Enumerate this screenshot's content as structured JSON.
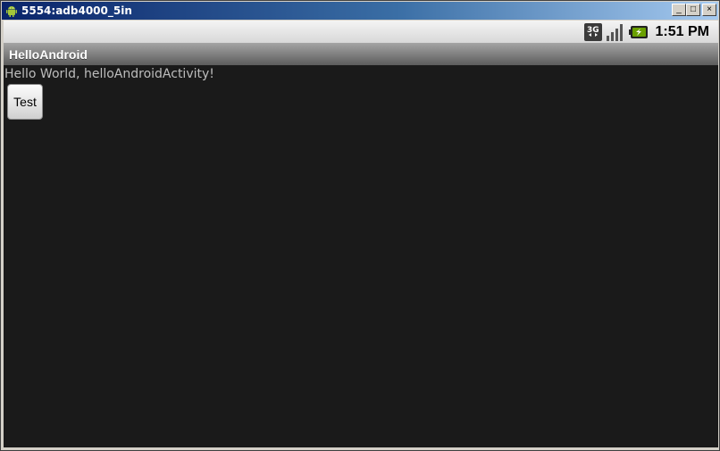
{
  "window": {
    "title": "5554:adb4000_5in",
    "minimize_glyph": "_",
    "maximize_glyph": "□",
    "close_glyph": "×"
  },
  "statusbar": {
    "network_icon": "3g-icon",
    "signal_icon": "signal-strength-icon",
    "battery_icon": "battery-charging-icon",
    "time": "1:51 PM"
  },
  "app": {
    "title": "HelloAndroid",
    "hello_text": "Hello World, helloAndroidActivity!",
    "button_label": "Test"
  },
  "colors": {
    "screen_bg": "#1a1a1a",
    "hello_text": "#bdbdbd",
    "titlebar_start": "#0a246a",
    "titlebar_end": "#a6caf0",
    "battery_green": "#6aa000"
  }
}
